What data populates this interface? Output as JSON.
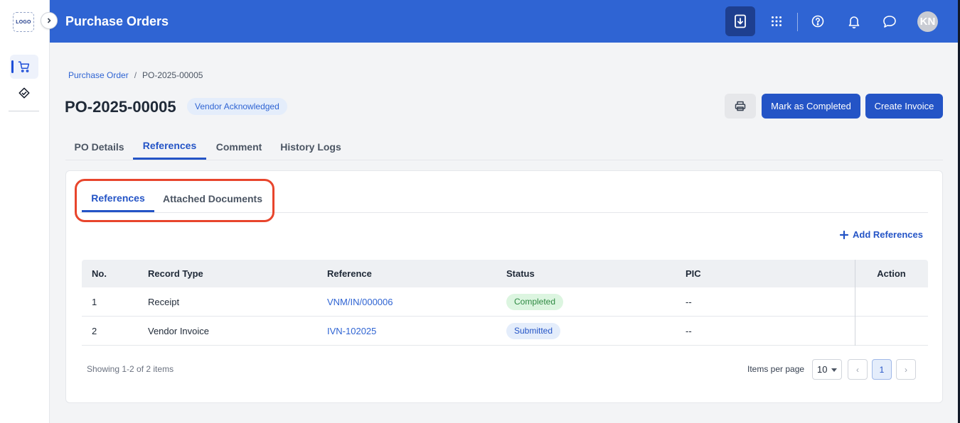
{
  "rail": {
    "logo_text": "LOGO",
    "items": [
      {
        "icon": "cart-icon",
        "active": true
      },
      {
        "icon": "handshake-icon",
        "active": false
      }
    ]
  },
  "header": {
    "title": "Purchase Orders",
    "avatar_initials": "KN"
  },
  "breadcrumb": {
    "parent": "Purchase Order",
    "separator": "/",
    "current": "PO-2025-00005"
  },
  "page": {
    "title": "PO-2025-00005",
    "status": "Vendor Acknowledged"
  },
  "actions": {
    "mark_completed": "Mark as Completed",
    "create_invoice": "Create Invoice"
  },
  "tabs": [
    {
      "label": "PO Details",
      "active": false
    },
    {
      "label": "References",
      "active": true
    },
    {
      "label": "Comment",
      "active": false
    },
    {
      "label": "History Logs",
      "active": false
    }
  ],
  "subtabs": [
    {
      "label": "References",
      "active": true
    },
    {
      "label": "Attached Documents",
      "active": false
    }
  ],
  "add_references_label": "Add References",
  "table": {
    "columns": [
      "No.",
      "Record Type",
      "Reference",
      "Status",
      "PIC",
      "Action"
    ],
    "rows": [
      {
        "no": "1",
        "record_type": "Receipt",
        "reference": "VNM/IN/000006",
        "status": "Completed",
        "pic": "--"
      },
      {
        "no": "2",
        "record_type": "Vendor Invoice",
        "reference": "IVN-102025",
        "status": "Submitted",
        "pic": "--"
      }
    ]
  },
  "pagination": {
    "showing": "Showing 1-2 of 2 items",
    "items_per_page_label": "Items per page",
    "items_per_page": "10",
    "current_page": "1",
    "prev": "‹",
    "next": "›"
  },
  "colors": {
    "header": "#2f64d3",
    "primary": "#2454c6",
    "highlight": "#e8452c",
    "success": "#2f8a43"
  }
}
